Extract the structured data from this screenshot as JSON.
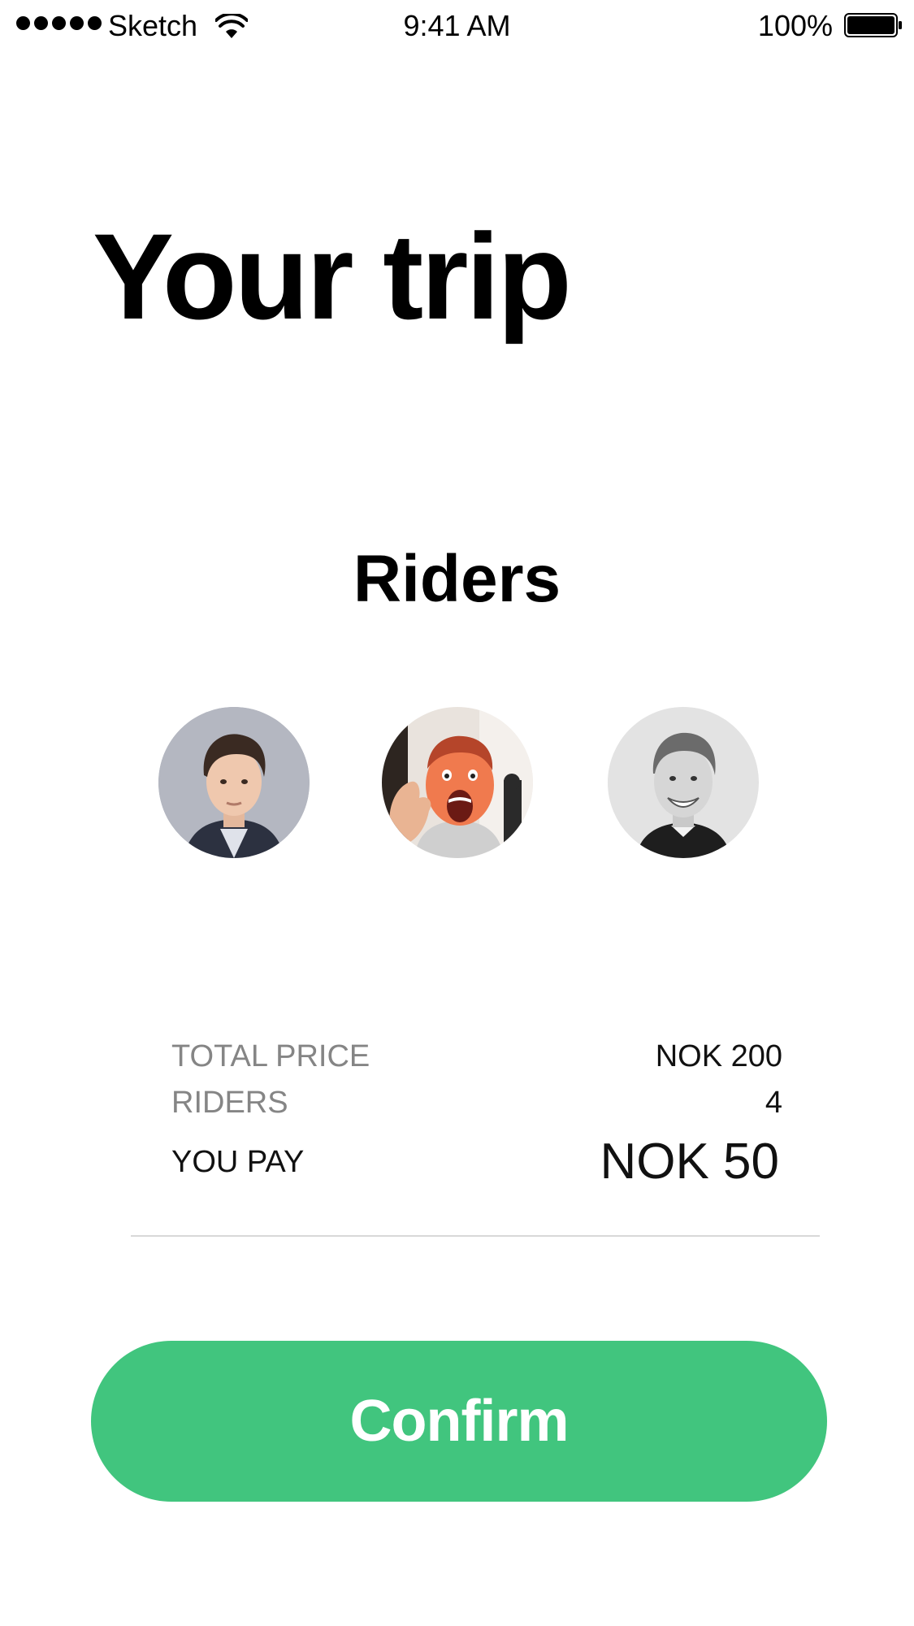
{
  "status_bar": {
    "carrier": "Sketch",
    "time": "9:41 AM",
    "battery_percent": "100%",
    "signal_icon": "signal-dots-icon",
    "wifi_icon": "wifi-icon",
    "battery_icon": "battery-full-icon"
  },
  "title": "Your trip",
  "riders_section": {
    "heading": "Riders",
    "avatars": [
      "avatar-rider-1",
      "avatar-rider-2",
      "avatar-rider-3"
    ]
  },
  "summary": {
    "total_price_label": "TOTAL PRICE",
    "total_price_value": "NOK 200",
    "riders_label": "RIDERS",
    "riders_value": "4",
    "you_pay_label": "YOU PAY",
    "you_pay_value": "NOK 50"
  },
  "confirm_button": {
    "label": "Confirm",
    "color": "#41c57e"
  }
}
